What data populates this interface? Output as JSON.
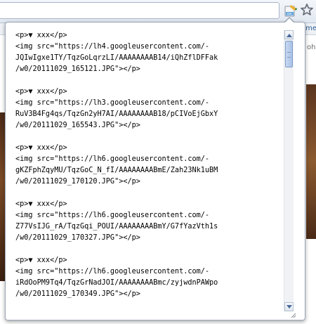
{
  "browser": {
    "extension_icon": "rss-feed-icon",
    "bookmark_icon": "star-icon",
    "side_text": "ohr",
    "top_link": ".me"
  },
  "popup": {
    "entries": [
      {
        "line1": "<p>▼ xxx</p>",
        "line2": "<img src=\"https://lh4.googleusercontent.com/-",
        "line3": "JQIwIgxe1TY/TqzGoLqrzLI/AAAAAAAAB14/iQhZflDFFak",
        "line4": "/w0/20111029_165121.JPG\"></p>"
      },
      {
        "line1": "<p>▼ xxx</p>",
        "line2": "<img src=\"https://lh3.googleusercontent.com/-",
        "line3": "RuV3B4Fg4qs/TqzGn2yH7AI/AAAAAAAAB18/pCIVoEjGbxY",
        "line4": "/w0/20111029_165543.JPG\"></p>"
      },
      {
        "line1": "<p>▼ xxx</p>",
        "line2": "<img src=\"https://lh6.googleusercontent.com/-",
        "line3": "gKZFphZqyMU/TqzGoC_N_fI/AAAAAAAABmE/Zah23Nk1uBM",
        "line4": "/w0/20111029_170120.JPG\"></p>"
      },
      {
        "line1": "<p>▼ xxx</p>",
        "line2": "<img src=\"https://lh6.googleusercontent.com/-",
        "line3": "Z77VsIJG_rA/TqzGqi_POUI/AAAAAAAABmY/G7fYazVth1s",
        "line4": "/w0/20111029_170327.JPG\"></p>"
      },
      {
        "line1": "<p>▼ xxx</p>",
        "line2": "<img src=\"https://lh6.googleusercontent.com/-",
        "line3": "iRdOoPM9Tq4/TqzGrNadJOI/AAAAAAAABmc/zyjwdnPAWpo",
        "line4": "/w0/20111029_170349.JPG\"></p>"
      }
    ]
  },
  "colors": {
    "scroll_thumb": "#a9c1e6",
    "popup_border": "#9aa5b5"
  }
}
